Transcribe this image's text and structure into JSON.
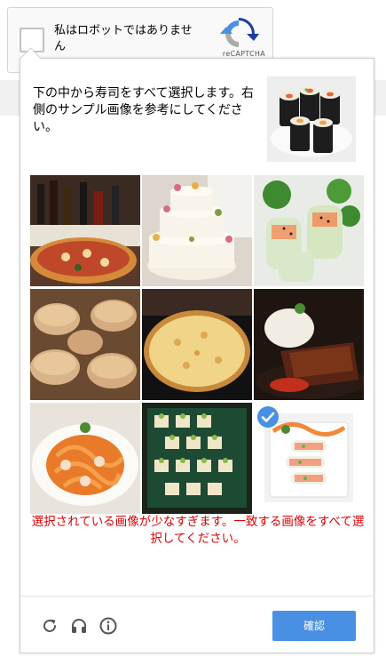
{
  "anchor": {
    "label": "私はロボットではありません",
    "brand": "reCAPTCHA"
  },
  "challenge": {
    "instruction": "下の中から寿司をすべて選択します。右側のサンプル画像を参考にしてください。",
    "sample": "sushi-roll",
    "tiles": [
      {
        "subject": "pizza-with-wine",
        "selected": false
      },
      {
        "subject": "wedding-cake",
        "selected": false
      },
      {
        "subject": "spring-rolls",
        "selected": false
      },
      {
        "subject": "pies-bakery",
        "selected": false
      },
      {
        "subject": "cheese-pizza",
        "selected": false
      },
      {
        "subject": "steak-with-rice",
        "selected": false
      },
      {
        "subject": "pasta",
        "selected": false
      },
      {
        "subject": "appetizer-platter",
        "selected": false
      },
      {
        "subject": "sushi-plate",
        "selected": true
      }
    ],
    "error": "選択されている画像が少なすぎます。一致する画像をすべて選択してください。"
  },
  "footer": {
    "verify": "確認",
    "icons": [
      "reload-icon",
      "audio-icon",
      "info-icon"
    ]
  },
  "colors": {
    "accent": "#4a90e2",
    "error": "#dd0000"
  }
}
